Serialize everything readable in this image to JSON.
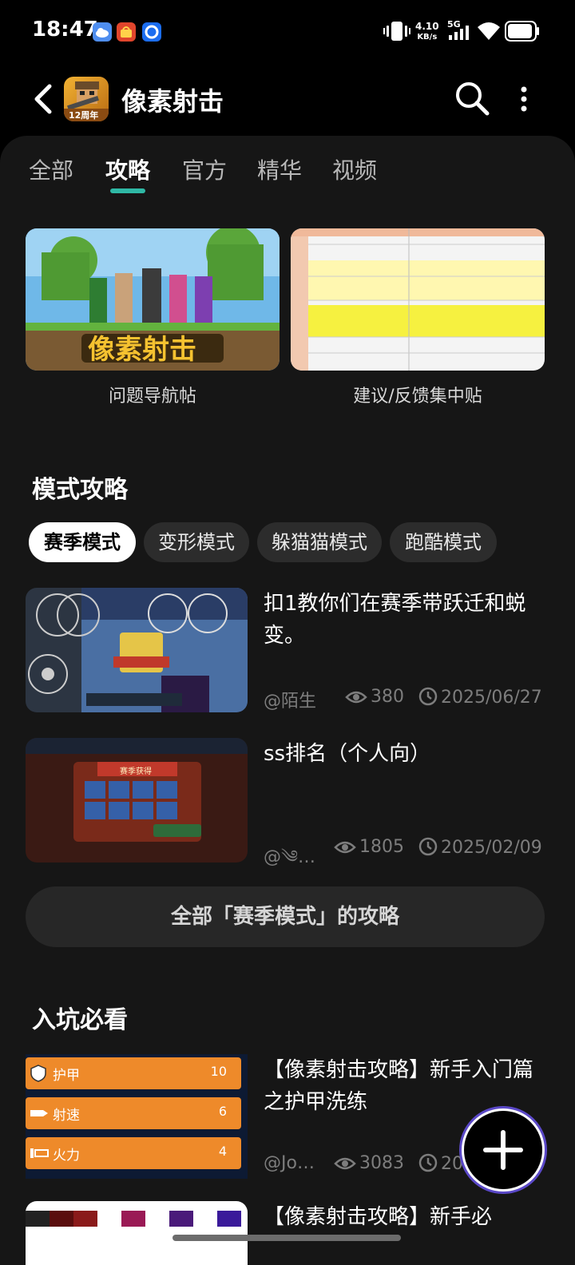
{
  "status_bar": {
    "time": "18:47",
    "net_speed_value": "4.10",
    "net_speed_unit": "KB/s",
    "signal": "5G",
    "icons": [
      "cloud-icon",
      "shop-icon",
      "browser-icon",
      "vibrate-icon",
      "signal-icon",
      "wifi-icon",
      "battery-icon"
    ]
  },
  "header": {
    "title": "像素射击",
    "game_icon_badge": "12周年"
  },
  "tabs": [
    {
      "label": "全部",
      "active": false
    },
    {
      "label": "攻略",
      "active": true
    },
    {
      "label": "官方",
      "active": false
    },
    {
      "label": "精华",
      "active": false
    },
    {
      "label": "视频",
      "active": false
    }
  ],
  "banners": [
    {
      "caption": "问题导航帖",
      "image_text": "像素射击"
    },
    {
      "caption": "建议/反馈集中贴"
    }
  ],
  "mode_section": {
    "title": "模式攻略",
    "chips": [
      {
        "label": "赛季模式",
        "active": true
      },
      {
        "label": "变形模式",
        "active": false
      },
      {
        "label": "躲猫猫模式",
        "active": false
      },
      {
        "label": "跑酷模式",
        "active": false
      }
    ],
    "posts": [
      {
        "title": "扣1教你们在赛季带跃迁和蜕变。",
        "author": "@陌生",
        "views": "380",
        "date": "2025/06/27"
      },
      {
        "title": "ss排名（个人向）",
        "author": "@༄…",
        "views": "1805",
        "date": "2025/02/09",
        "thumb_text": "赛季获得"
      }
    ],
    "all_button": "全部「赛季模式」的攻略"
  },
  "newbie_section": {
    "title": "入坑必看",
    "posts": [
      {
        "title": "【像素射击攻略】新手入门篇之护甲洗练",
        "author": "@Jo…",
        "views": "3083",
        "date": "2025/06/27",
        "stats": [
          {
            "label": "护甲",
            "value": "10"
          },
          {
            "label": "射速",
            "value": "6"
          },
          {
            "label": "火力",
            "value": "4"
          }
        ]
      },
      {
        "title": "【像素射击攻略】新手必"
      }
    ]
  },
  "colors": {
    "accent": "#2fb8a5",
    "panel": "#161616",
    "chip": "#2c2c2c",
    "stat_bar": "#ee8a2a"
  }
}
